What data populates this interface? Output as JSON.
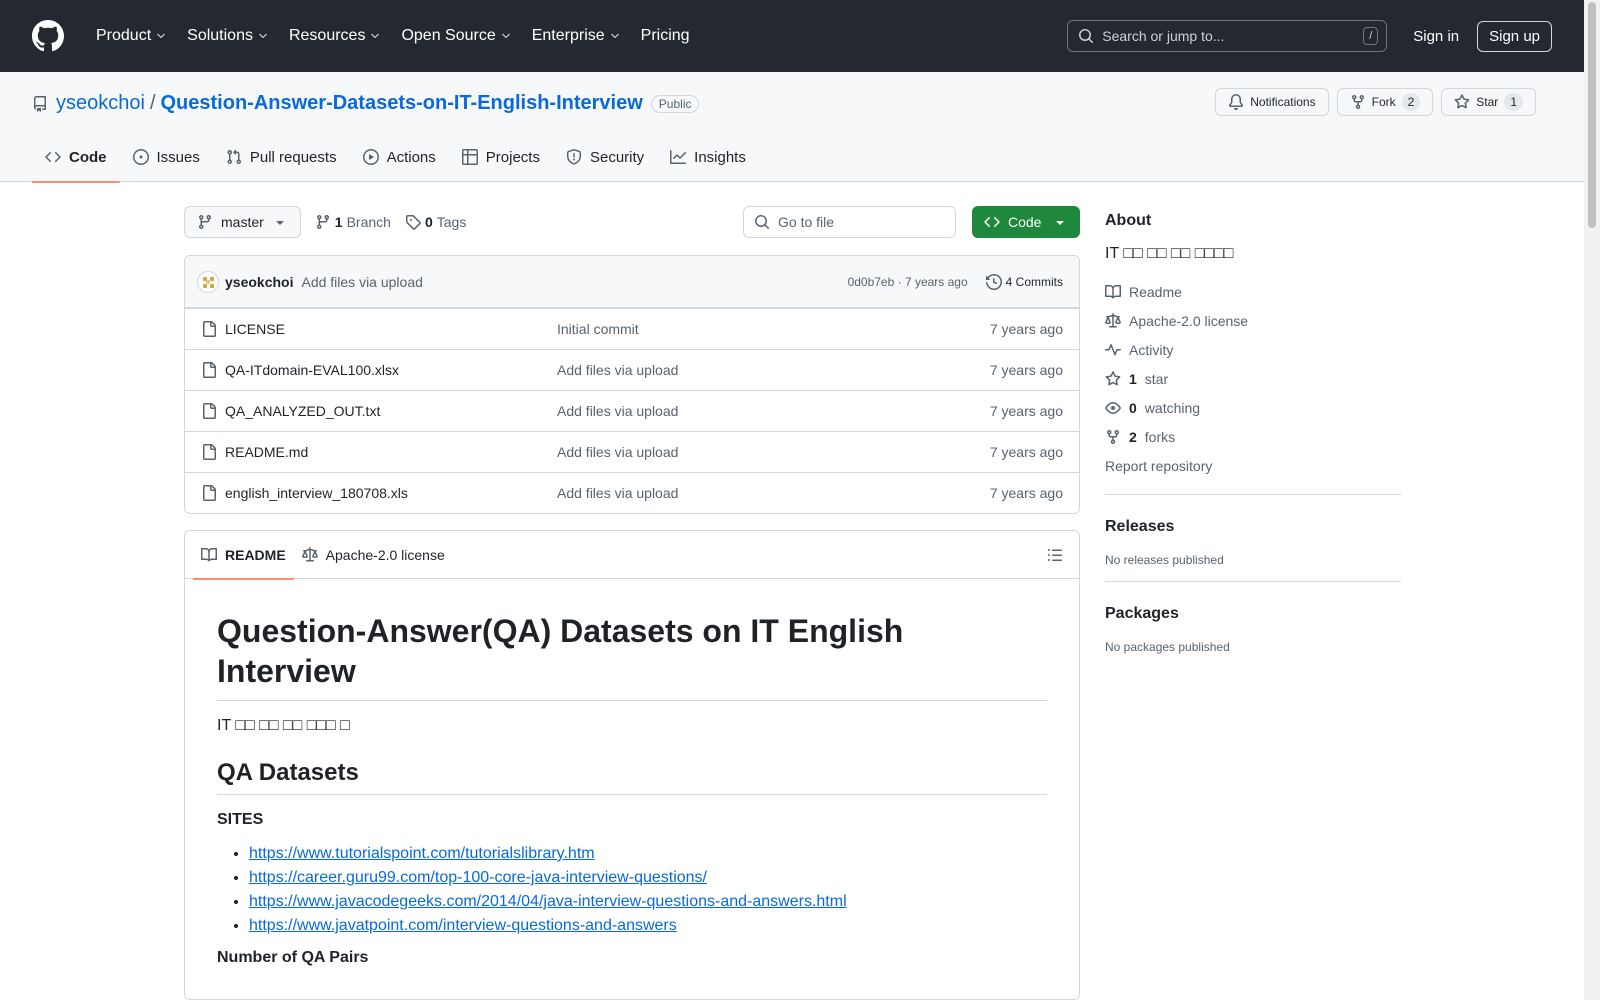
{
  "header": {
    "nav": [
      "Product",
      "Solutions",
      "Resources",
      "Open Source",
      "Enterprise",
      "Pricing"
    ],
    "search_placeholder": "Search or jump to...",
    "search_shortcut": "/",
    "signin": "Sign in",
    "signup": "Sign up"
  },
  "repo": {
    "owner": "yseokchoi",
    "separator": "/",
    "name": "Question-Answer-Datasets-on-IT-English-Interview",
    "visibility": "Public",
    "notifications": "Notifications",
    "fork": "Fork",
    "fork_count": "2",
    "star": "Star",
    "star_count": "1"
  },
  "tabs": [
    {
      "label": "Code",
      "icon": "code-icon"
    },
    {
      "label": "Issues",
      "icon": "issue-icon"
    },
    {
      "label": "Pull requests",
      "icon": "pull-request-icon"
    },
    {
      "label": "Actions",
      "icon": "play-icon"
    },
    {
      "label": "Projects",
      "icon": "table-icon"
    },
    {
      "label": "Security",
      "icon": "shield-icon"
    },
    {
      "label": "Insights",
      "icon": "graph-icon"
    }
  ],
  "filenav": {
    "branch": "master",
    "branch_count": "1",
    "branch_label": "Branch",
    "tag_count": "0",
    "tag_label": "Tags",
    "goto_placeholder": "Go to file",
    "code_button": "Code"
  },
  "commit": {
    "user": "yseokchoi",
    "message": "Add files via upload",
    "hash_time": "0d0b7eb · 7 years ago",
    "commits": "4 Commits"
  },
  "files": [
    {
      "name": "LICENSE",
      "message": "Initial commit",
      "age": "7 years ago"
    },
    {
      "name": "QA-ITdomain-EVAL100.xlsx",
      "message": "Add files via upload",
      "age": "7 years ago"
    },
    {
      "name": "QA_ANALYZED_OUT.txt",
      "message": "Add files via upload",
      "age": "7 years ago"
    },
    {
      "name": "README.md",
      "message": "Add files via upload",
      "age": "7 years ago"
    },
    {
      "name": "english_interview_180708.xls",
      "message": "Add files via upload",
      "age": "7 years ago"
    }
  ],
  "readme": {
    "tab_readme": "README",
    "tab_license": "Apache-2.0 license",
    "title": "Question-Answer(QA) Datasets on IT English Interview",
    "intro": "IT □□ □□ □□ □□□ □",
    "h2": "QA Datasets",
    "sites_heading": "SITES",
    "links": [
      "https://www.tutorialspoint.com/tutorialslibrary.htm",
      "https://career.guru99.com/top-100-core-java-interview-questions/",
      "https://www.javacodegeeks.com/2014/04/java-interview-questions-and-answers.html",
      "https://www.javatpoint.com/interview-questions-and-answers"
    ],
    "pairs_heading": "Number of QA Pairs"
  },
  "sidebar": {
    "about": "About",
    "description": "IT □□ □□ □□ □□□□",
    "readme": "Readme",
    "license": "Apache-2.0 license",
    "activity": "Activity",
    "stars_count": "1",
    "stars_label": "star",
    "watching_count": "0",
    "watching_label": "watching",
    "forks_count": "2",
    "forks_label": "forks",
    "report": "Report repository",
    "releases": "Releases",
    "releases_none": "No releases published",
    "packages": "Packages",
    "packages_none": "No packages published"
  }
}
